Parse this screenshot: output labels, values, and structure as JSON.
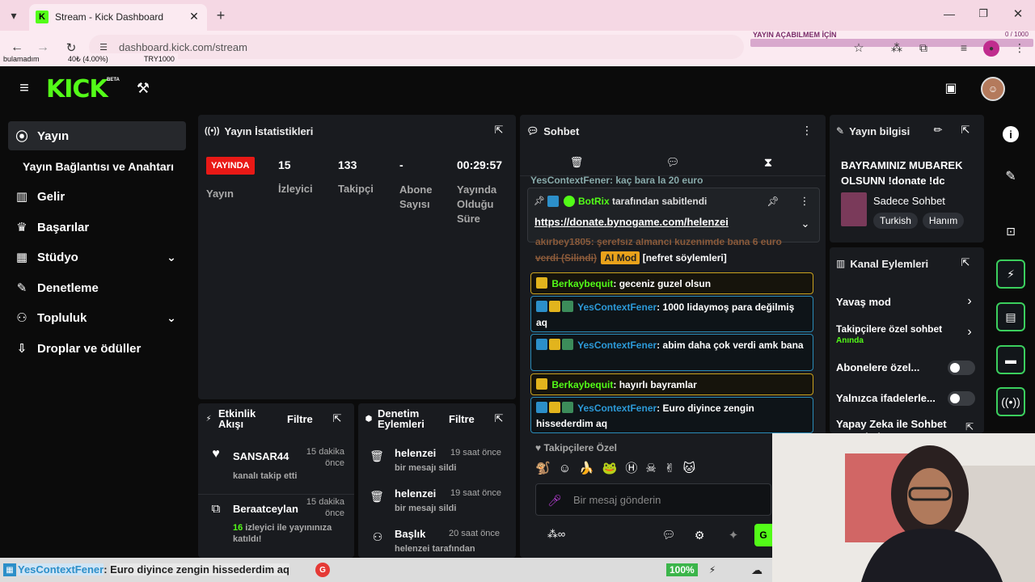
{
  "browser": {
    "tab_title": "Stream - Kick Dashboard",
    "url": "dashboard.kick.com/stream",
    "overlay_text": "YAYIN AÇABILMEM İÇİN",
    "overlay_counter": "0 / 1000",
    "goal_left": "bulamadım",
    "goal_mid": "40₺ (4.00%)",
    "goal_right": "TRY1000"
  },
  "header": {
    "logo": "KICK",
    "beta": "BETA"
  },
  "sidebar": {
    "items": [
      {
        "label": "Yayın"
      },
      {
        "label": "Yayın Bağlantısı ve Anahtarı"
      },
      {
        "label": "Gelir"
      },
      {
        "label": "Başarılar"
      },
      {
        "label": "Stüdyo"
      },
      {
        "label": "Denetleme"
      },
      {
        "label": "Topluluk"
      },
      {
        "label": "Droplar ve ödüller"
      }
    ]
  },
  "stats": {
    "title": "Yayın İstatistikleri",
    "live_badge": "YAYINDA",
    "live_label": "Yayın",
    "viewers": "15",
    "viewers_label": "İzleyici",
    "followers": "133",
    "followers_label": "Takipçi",
    "subs": "-",
    "subs_label": "Abone Sayısı",
    "duration": "00:29:57",
    "duration_label": "Yayında Olduğu Süre"
  },
  "activity": {
    "title": "Etkinlik Akışı",
    "filter": "Filtre",
    "items": [
      {
        "user": "SANSAR44",
        "time": "15 dakika önce",
        "desc": "kanalı takip etti"
      },
      {
        "user": "Beraatceylan",
        "time": "15 dakika önce",
        "count": "16",
        "desc": " izleyici ile yayınınıza katıldı!"
      }
    ]
  },
  "moderation": {
    "title": "Denetim Eylemleri",
    "filter": "Filtre",
    "items": [
      {
        "user": "helenzei",
        "time": "19 saat önce",
        "desc": "bir mesajı sildi"
      },
      {
        "user": "helenzei",
        "time": "19 saat önce",
        "desc": "bir mesajı sildi"
      },
      {
        "user": "Başlık",
        "time": "20 saat önce",
        "desc": "helenzei tarafından"
      }
    ]
  },
  "chat": {
    "title": "Sohbet",
    "pinned_by": "BotRix",
    "pinned_suffix": "tarafından sabitlendi",
    "pinned_link": "https://donate.bynogame.com/helenzei",
    "partial_top": "YesContextFener: kaç bara la 20 euro",
    "partial_mid": "akirbey1805: şerefsiz almanci kuzenimde bana 6 euro",
    "deleted": "verdi (Silindi)",
    "ai_mod": "AI Mod",
    "ai_reason": "[nefret söylemleri]",
    "messages": [
      {
        "user": "Berkaybequit",
        "text": "geceniz guzel olsun"
      },
      {
        "user": "YesContextFener",
        "text": "1000 lidaymoş para değilmiş aq"
      },
      {
        "user": "YesContextFener",
        "text": "abim daha çok verdi amk bana"
      },
      {
        "user": "Berkaybequit",
        "text": "hayırlı bayramlar"
      },
      {
        "user": "YesContextFener",
        "text": "Euro diyince zengin hissederdim aq"
      }
    ],
    "followers_only": "Takipçilere Özel",
    "input_placeholder": "Bir mesaj gönderin",
    "send": "G"
  },
  "stream_info": {
    "title": "Yayın bilgisi",
    "stream_title": "BAYRAMINIZ MUBAREK OLSUNN !donate !dc",
    "category": "Sadece Sohbet",
    "tags": [
      "Turkish",
      "Hanım"
    ]
  },
  "channel_actions": {
    "title": "Kanal Eylemleri",
    "slow_mode": "Yavaş mod",
    "followers_chat": "Takipçilere özel sohbet",
    "followers_chat_sub": "Anında",
    "subs_only": "Abonelere özel...",
    "emotes_only": "Yalnızca ifadelerle...",
    "ai_chat": "Yapay Zeka ile Sohbet Denetimi"
  },
  "taskbar": {
    "ticker_user": "YesContextFener",
    "ticker_text": "Euro diyince zengin hissederdim aq",
    "battery": "100%"
  },
  "colors": {
    "kick_green": "#53fc18",
    "live_red": "#e91916",
    "chat_blue": "#2c8fc9",
    "gold": "#c9a21f"
  }
}
